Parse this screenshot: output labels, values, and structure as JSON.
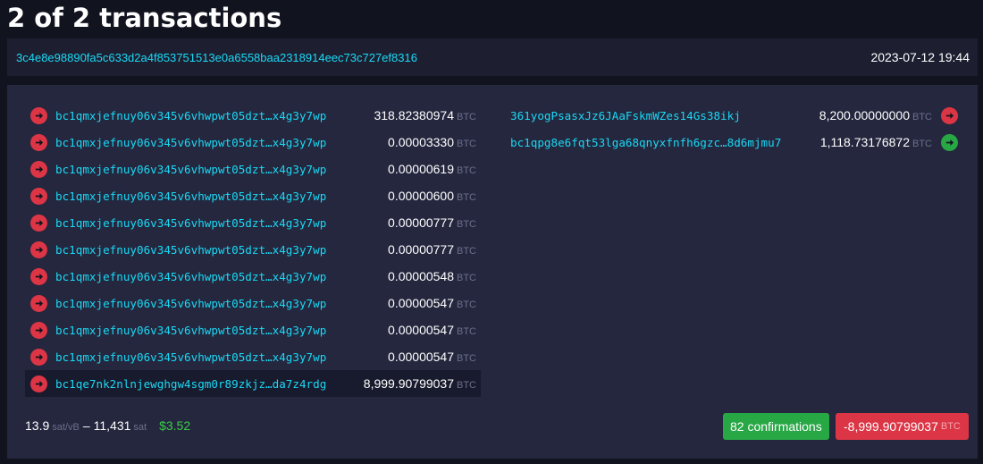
{
  "page_title": "2 of 2 transactions",
  "tx": {
    "txid": "3c4e8e98890fa5c633d2a4f853751513e0a6558baa2318914eec73c727ef8316",
    "time": "2023-07-12 19:44"
  },
  "colors": {
    "background": "#11131f",
    "panel": "#24273e",
    "header_panel": "#1d1f31",
    "link": "#1bd8f4",
    "red": "#dc3545",
    "green": "#28a745",
    "muted": "#6c6f89"
  },
  "unit_label": "BTC",
  "inputs": [
    {
      "addr_head": "bc1qmxjefnuy06v345v6vhwpwt05dzt…",
      "addr_tail": "x4g3y7wp",
      "amount": "318.82380974",
      "icon": "arrow-right-red-icon"
    },
    {
      "addr_head": "bc1qmxjefnuy06v345v6vhwpwt05dzt…",
      "addr_tail": "x4g3y7wp",
      "amount": "0.00003330",
      "icon": "arrow-right-red-icon"
    },
    {
      "addr_head": "bc1qmxjefnuy06v345v6vhwpwt05dzt…",
      "addr_tail": "x4g3y7wp",
      "amount": "0.00000619",
      "icon": "arrow-right-red-icon"
    },
    {
      "addr_head": "bc1qmxjefnuy06v345v6vhwpwt05dzt…",
      "addr_tail": "x4g3y7wp",
      "amount": "0.00000600",
      "icon": "arrow-right-red-icon"
    },
    {
      "addr_head": "bc1qmxjefnuy06v345v6vhwpwt05dzt…",
      "addr_tail": "x4g3y7wp",
      "amount": "0.00000777",
      "icon": "arrow-right-red-icon"
    },
    {
      "addr_head": "bc1qmxjefnuy06v345v6vhwpwt05dzt…",
      "addr_tail": "x4g3y7wp",
      "amount": "0.00000777",
      "icon": "arrow-right-red-icon"
    },
    {
      "addr_head": "bc1qmxjefnuy06v345v6vhwpwt05dzt…",
      "addr_tail": "x4g3y7wp",
      "amount": "0.00000548",
      "icon": "arrow-right-red-icon"
    },
    {
      "addr_head": "bc1qmxjefnuy06v345v6vhwpwt05dzt…",
      "addr_tail": "x4g3y7wp",
      "amount": "0.00000547",
      "icon": "arrow-right-red-icon"
    },
    {
      "addr_head": "bc1qmxjefnuy06v345v6vhwpwt05dzt…",
      "addr_tail": "x4g3y7wp",
      "amount": "0.00000547",
      "icon": "arrow-right-red-icon"
    },
    {
      "addr_head": "bc1qmxjefnuy06v345v6vhwpwt05dzt…",
      "addr_tail": "x4g3y7wp",
      "amount": "0.00000547",
      "icon": "arrow-right-red-icon"
    },
    {
      "addr_head": "bc1qe7nk2nlnjewghgw4sgm0r89zkjz…",
      "addr_tail": "da7z4rdg",
      "amount": "8,999.90799037",
      "icon": "arrow-right-red-icon",
      "highlighted": true
    }
  ],
  "outputs": [
    {
      "addr_head": "361yogPsasxJz6JAaFskmWZes14Gs38ikj",
      "addr_tail": "",
      "amount": "8,200.00000000",
      "icon": "arrow-right-red-icon"
    },
    {
      "addr_head": "bc1qpg8e6fqt53lga68qnyxfnfh6gzc…",
      "addr_tail": "8d6mjmu7",
      "amount": "1,118.73176872",
      "icon": "arrow-right-green-icon"
    }
  ],
  "footer": {
    "fee_rate": "13.9",
    "fee_rate_unit": "sat/vB",
    "separator": "–",
    "fee": "11,431",
    "fee_unit": "sat",
    "fee_usd": "$3.52",
    "confirmations": "82 confirmations",
    "net_amount": "-8,999.90799037",
    "net_unit": "BTC"
  }
}
